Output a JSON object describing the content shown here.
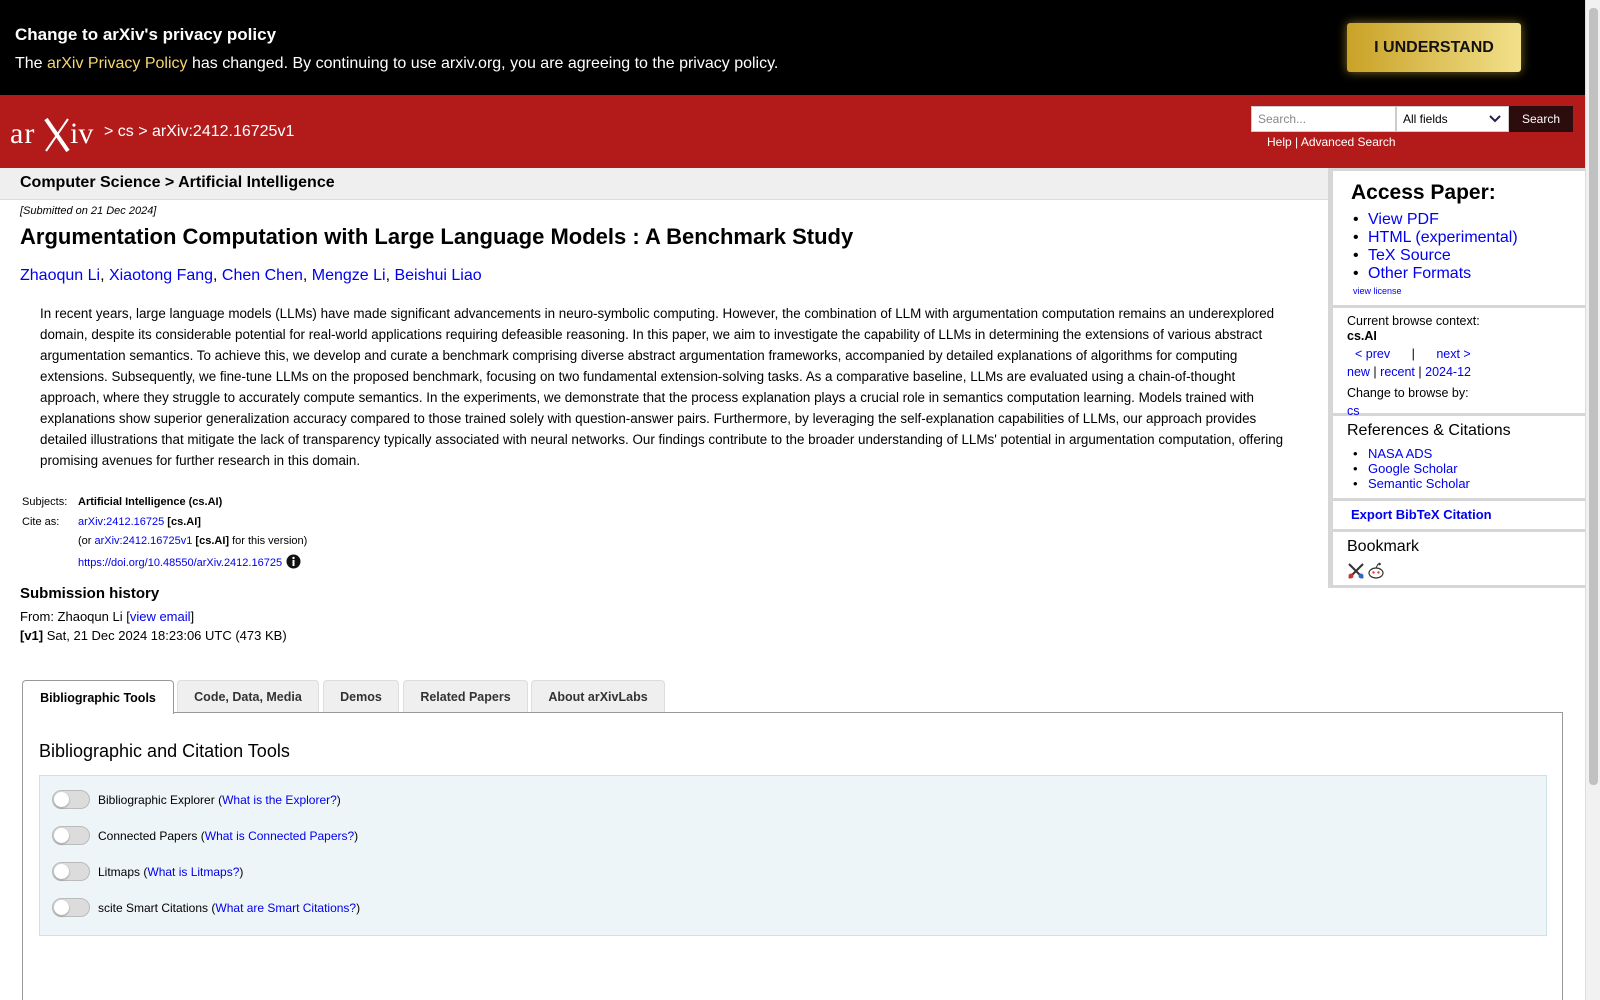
{
  "privacy": {
    "title": "Change to arXiv's privacy policy",
    "text_before": "The ",
    "link": "arXiv Privacy Policy",
    "text_after": " has changed. By continuing to use arxiv.org, you are agreeing to the privacy policy.",
    "button": "I UNDERSTAND"
  },
  "header": {
    "breadcrumb": "> cs > arXiv:2412.16725v1",
    "search_placeholder": "Search...",
    "field_select": "All fields",
    "search_button": "Search",
    "help": "Help",
    "sep": " | ",
    "advanced": "Advanced Search"
  },
  "subject_bar": "Computer Science > Artificial Intelligence",
  "paper": {
    "submitted": "[Submitted on 21 Dec 2024]",
    "title": "Argumentation Computation with Large Language Models : A Benchmark Study",
    "authors": [
      "Zhaoqun Li",
      "Xiaotong Fang",
      "Chen Chen",
      "Mengze Li",
      "Beishui Liao"
    ],
    "author_sep": ", ",
    "abstract": "In recent years, large language models (LLMs) have made significant advancements in neuro-symbolic computing. However, the combination of LLM with argumentation computation remains an underexplored domain, despite its considerable potential for real-world applications requiring defeasible reasoning. In this paper, we aim to investigate the capability of LLMs in determining the extensions of various abstract argumentation semantics. To achieve this, we develop and curate a benchmark comprising diverse abstract argumentation frameworks, accompanied by detailed explanations of algorithms for computing extensions. Subsequently, we fine-tune LLMs on the proposed benchmark, focusing on two fundamental extension-solving tasks. As a comparative baseline, LLMs are evaluated using a chain-of-thought approach, where they struggle to accurately compute semantics. In the experiments, we demonstrate that the process explanation plays a crucial role in semantics computation learning. Models trained with explanations show superior generalization accuracy compared to those trained solely with question-answer pairs. Furthermore, by leveraging the self-explanation capabilities of LLMs, our approach provides detailed illustrations that mitigate the lack of transparency typically associated with neural networks. Our findings contribute to the broader understanding of LLMs' potential in argumentation computation, offering promising avenues for further research in this domain."
  },
  "meta": {
    "subjects_label": "Subjects:",
    "subjects_value": "Artificial Intelligence (cs.AI)",
    "cite_label": "Cite as:",
    "cite_link": "arXiv:2412.16725",
    "cite_tag": " [cs.AI]",
    "or_prefix": "(or ",
    "version_link": "arXiv:2412.16725v1",
    "version_tag": " [cs.AI]",
    "version_suffix": " for this version)",
    "doi": "https://doi.org/10.48550/arXiv.2412.16725"
  },
  "history": {
    "title": "Submission history",
    "from_prefix": "From: Zhaoqun Li [",
    "view_email": "view email",
    "from_suffix": "]",
    "v1_label": "[v1]",
    "v1_text": " Sat, 21 Dec 2024 18:23:06 UTC (473 KB)"
  },
  "tabs": [
    "Bibliographic Tools",
    "Code, Data, Media",
    "Demos",
    "Related Papers",
    "About arXivLabs"
  ],
  "tools": {
    "title": "Bibliographic and Citation Tools",
    "items": [
      {
        "label": "Bibliographic Explorer",
        "link": "What is the Explorer?"
      },
      {
        "label": "Connected Papers",
        "link": "What is Connected Papers?"
      },
      {
        "label": "Litmaps",
        "link": "What is Litmaps?"
      },
      {
        "label": "scite Smart Citations",
        "link": "What are Smart Citations?"
      }
    ]
  },
  "sidebar": {
    "access_title": "Access Paper:",
    "access_links": [
      "View PDF",
      "HTML (experimental)",
      "TeX Source",
      "Other Formats"
    ],
    "view_license": "view license",
    "context_label": "Current browse context:",
    "context_value": "cs.AI",
    "prev": "< prev",
    "pipe": "|",
    "next": "next >",
    "new": "new",
    "recent": "recent",
    "month": "2024-12",
    "change_label": "Change to browse by:",
    "change_value": "cs",
    "refs_title": "References & Citations",
    "refs_links": [
      "NASA ADS",
      "Google Scholar",
      "Semantic Scholar"
    ],
    "export": "Export BibTeX Citation",
    "bookmark_title": "Bookmark"
  },
  "colors": {
    "brand_red": "#b31b1b",
    "link_blue": "#0000ee",
    "banner_black": "#000000",
    "button_gold": "#c9a227"
  }
}
